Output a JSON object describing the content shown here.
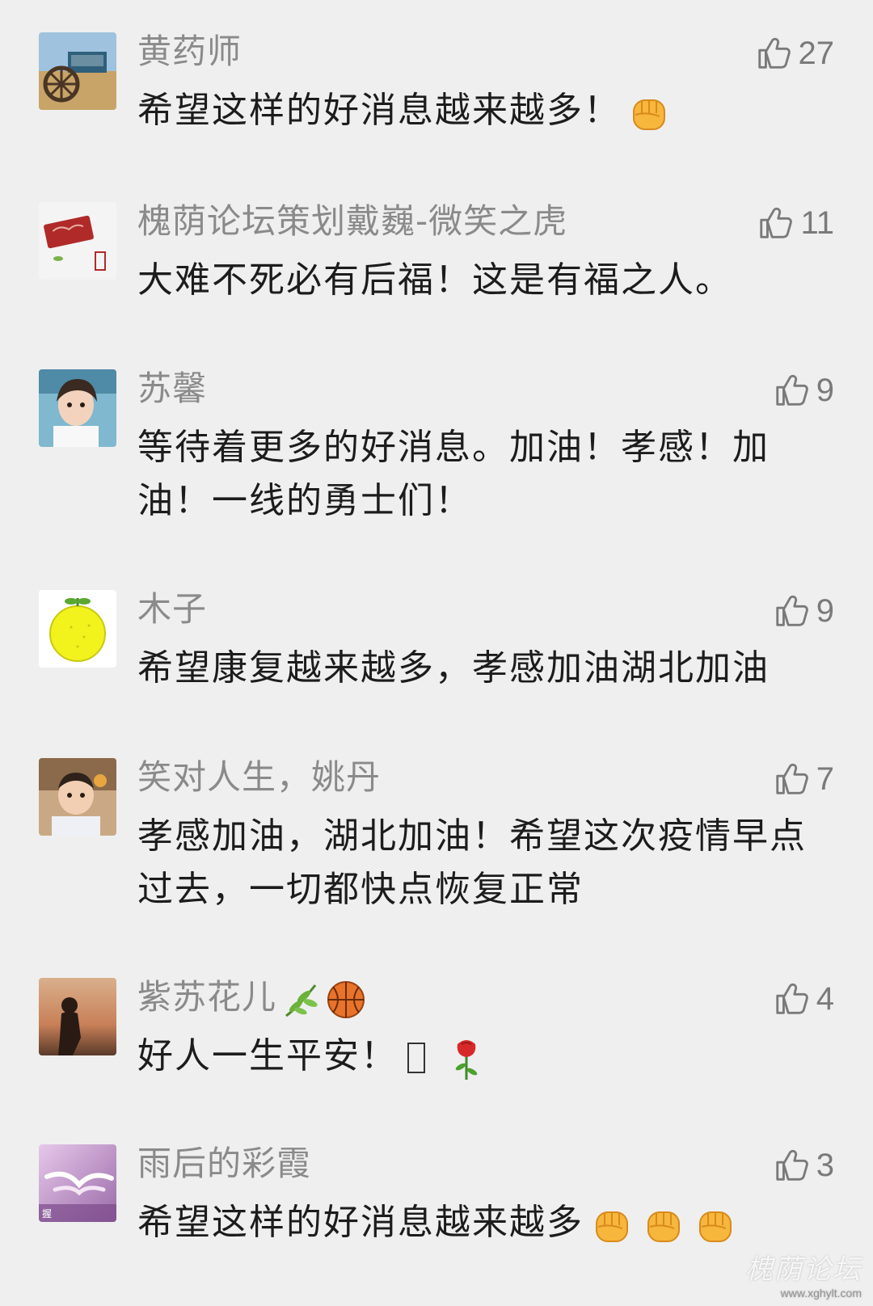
{
  "colors": {
    "background": "#efefef",
    "username": "#8a8a8a",
    "content": "#1c1c1c",
    "like": "#7a7a7a"
  },
  "comments": [
    {
      "username": "黄药师",
      "likes": "27",
      "text": "希望这样的好消息越来越多！",
      "emoji_after": [
        "fist-emoji"
      ],
      "avatar": "old-cart-avatar"
    },
    {
      "username": "槐荫论坛策划戴巍-微笑之虎",
      "likes": "11",
      "text": "大难不死必有后福！这是有福之人。",
      "avatar": "red-seal-avatar"
    },
    {
      "username": "苏馨",
      "likes": "9",
      "text": "等待着更多的好消息。加油！孝感！加油！一线的勇士们！",
      "avatar": "child-photo-avatar"
    },
    {
      "username": "木子",
      "likes": "9",
      "text": "希望康复越来越多，孝感加油湖北加油",
      "avatar": "lemon-avatar"
    },
    {
      "username": "笑对人生，姚丹",
      "likes": "7",
      "text": "孝感加油，湖北加油！希望这次疫情早点过去，一切都快点恢复正常",
      "avatar": "toddler-photo-avatar"
    },
    {
      "username": "紫苏花儿",
      "username_emoji": [
        "leaf-emoji",
        "basketball-emoji"
      ],
      "likes": "4",
      "text": "好人一生平安！",
      "emoji_after": [
        "missing-glyph",
        "rose-emoji"
      ],
      "avatar": "sunset-silhouette-avatar"
    },
    {
      "username": "雨后的彩霞",
      "likes": "3",
      "text": "希望这样的好消息越来越多",
      "emoji_after": [
        "fist-emoji",
        "fist-emoji",
        "fist-emoji"
      ],
      "avatar": "purple-hands-avatar",
      "avatar_caption": "握"
    }
  ],
  "watermark": {
    "main": "槐荫论坛",
    "sub": "www.xghylt.com"
  }
}
